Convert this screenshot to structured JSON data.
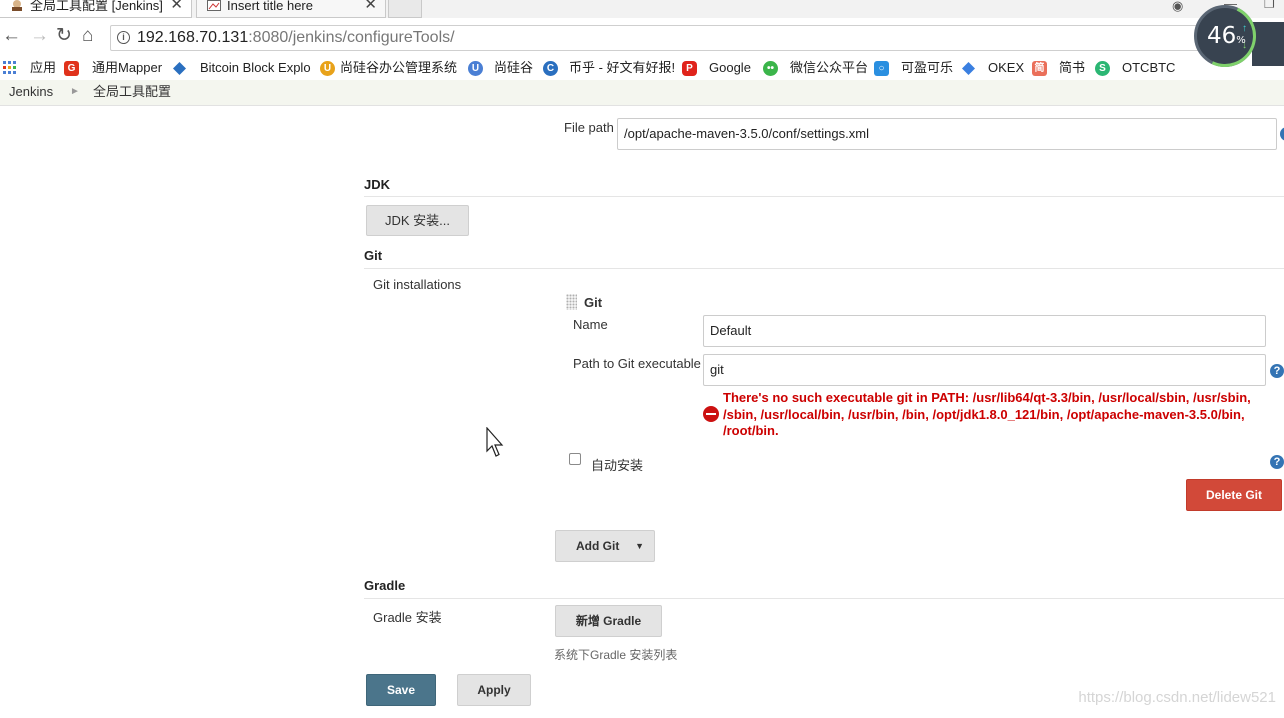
{
  "browser": {
    "tabs": [
      {
        "title": "全局工具配置 [Jenkins]",
        "close": "✕",
        "active": true
      },
      {
        "title": "Insert title here",
        "close": "✕",
        "active": false
      }
    ],
    "address": {
      "host": "192.168.70.131",
      "path": ":8080/jenkins/configureTools/"
    },
    "meter": {
      "value": "46",
      "unit": "%"
    },
    "bookmarks": [
      {
        "label": "应用",
        "icon": "apps-grid-icon",
        "color": "#4a7fd4"
      },
      {
        "label": "通用Mapper",
        "icon": "g-logo-icon",
        "color": "#e0321b"
      },
      {
        "label": "Bitcoin Block Explo",
        "icon": "diamond-icon",
        "color": "#2a6fbf"
      },
      {
        "label": "尚硅谷办公管理系统",
        "icon": "u-logo-icon",
        "color": "#e8a21a"
      },
      {
        "label": "尚硅谷",
        "icon": "u-logo-icon",
        "color": "#4a7fd4"
      },
      {
        "label": "币乎 - 好文有好报!",
        "icon": "c-logo-icon",
        "color": "#2a6fbf"
      },
      {
        "label": "Google",
        "icon": "p-logo-icon",
        "color": "#e0231b"
      },
      {
        "label": "微信公众平台",
        "icon": "wechat-icon",
        "color": "#3bb54a"
      },
      {
        "label": "可盈可乐",
        "icon": "k-logo-icon",
        "color": "#2a8fe0"
      },
      {
        "label": "OKEX",
        "icon": "diamond-icon",
        "color": "#3a7fe0"
      },
      {
        "label": "简书",
        "icon": "jianshu-icon",
        "color": "#ea6f5a"
      },
      {
        "label": "OTCBTC",
        "icon": "otc-logo-icon",
        "color": "#2bb673"
      }
    ]
  },
  "breadcrumb": {
    "root": "Jenkins",
    "current": "全局工具配置"
  },
  "maven": {
    "file_path_label": "File path",
    "file_path_value": "/opt/apache-maven-3.5.0/conf/settings.xml"
  },
  "jdk": {
    "heading": "JDK",
    "install_button": "JDK 安装..."
  },
  "git": {
    "heading": "Git",
    "installations_label": "Git installations",
    "block_title": "Git",
    "name_label": "Name",
    "name_value": "Default",
    "path_label": "Path to Git executable",
    "path_value": "git",
    "error_text": "There's no such executable git in PATH: /usr/lib64/qt-3.3/bin, /usr/local/sbin, /usr/sbin, /sbin, /usr/local/bin, /usr/bin, /bin, /opt/jdk1.8.0_121/bin, /opt/apache-maven-3.5.0/bin, /root/bin.",
    "auto_install_label": "自动安装",
    "auto_install_checked": false,
    "delete_button": "Delete Git",
    "add_button": "Add Git"
  },
  "gradle": {
    "heading": "Gradle",
    "install_label": "Gradle 安装",
    "add_button": "新增 Gradle",
    "hint": "系统下Gradle 安装列表"
  },
  "footer": {
    "save_button": "Save",
    "apply_button": "Apply"
  },
  "watermark": "https://blog.csdn.net/lidew521",
  "colors": {
    "save": "#4b758b",
    "delete": "#d24939",
    "error": "#cc0000",
    "breadcrumb_bg": "#f4f6ef"
  }
}
